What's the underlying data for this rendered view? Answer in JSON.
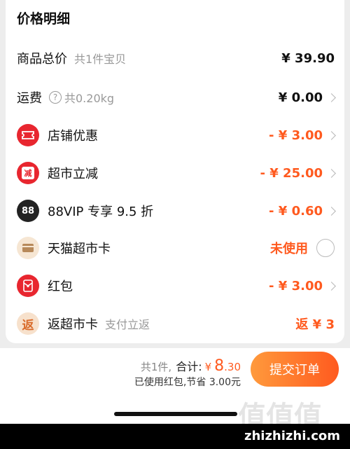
{
  "card": {
    "title": "价格明细"
  },
  "rows": {
    "total": {
      "label": "商品总价",
      "sub": "共1件宝贝",
      "amount": "¥ 39.90"
    },
    "shipping": {
      "label": "运费",
      "help": "?",
      "sub": "共0.20kg",
      "amount": "¥ 0.00"
    },
    "shop_discount": {
      "label": "店铺优惠",
      "amount": "- ¥ 3.00",
      "icon": "ticket-icon"
    },
    "market_cut": {
      "label": "超市立减",
      "amount": "- ¥ 25.00",
      "icon_text": "减",
      "icon": "discount-icon"
    },
    "vip": {
      "label": "88VIP 专享 9.5 折",
      "amount": "- ¥ 0.60",
      "icon_text": "88",
      "icon": "vip-88-icon"
    },
    "tmall_card": {
      "label": "天猫超市卡",
      "status": "未使用",
      "icon": "card-icon"
    },
    "red_packet": {
      "label": "红包",
      "amount": "- ¥ 3.00",
      "icon": "red-packet-icon"
    },
    "cashback": {
      "label": "返超市卡",
      "sub": "支付立返",
      "amount": "返 ¥ 3",
      "icon_text": "返",
      "icon": "cashback-icon"
    }
  },
  "footer": {
    "count": "共1件,",
    "sum_label": "合计:",
    "currency": "¥",
    "sum_int": "8",
    "sum_dec": ".30",
    "note": "已使用红包,节省 3.00元",
    "submit_label": "提交订单"
  },
  "watermark": {
    "logo_chars": "值值值",
    "text": "zhizhizhi.com"
  },
  "colors": {
    "accent": "#ff5a1f",
    "red": "#e8262f",
    "grey_text": "#999999"
  }
}
